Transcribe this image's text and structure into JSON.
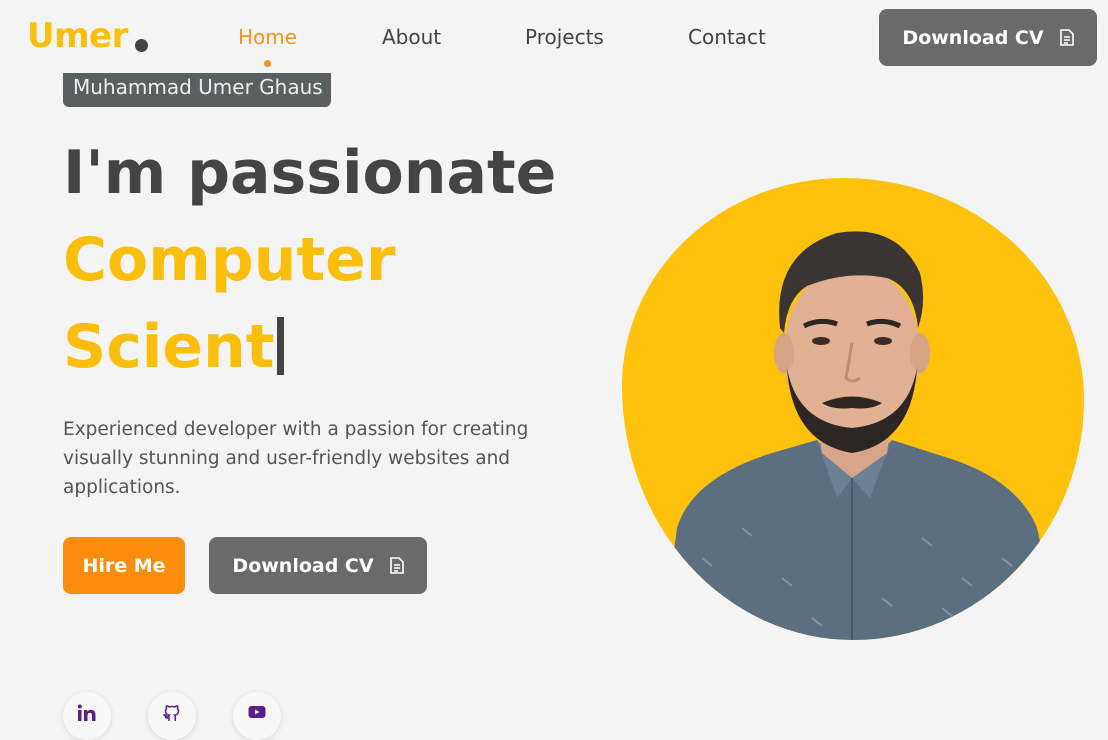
{
  "nav": {
    "logo": "Umer",
    "links": [
      "Home",
      "About",
      "Projects",
      "Contact"
    ],
    "active": "Home",
    "download_cv": "Download CV"
  },
  "hero": {
    "name_badge": "Muhammad Umer Ghaus",
    "line1": "I'm passionate",
    "line2": "Computer",
    "line3": "Scient",
    "description": "Experienced developer with a passion for creating visually stunning and user-friendly websites and applications.",
    "hire_me": "Hire Me",
    "download_cv": "Download CV"
  },
  "social": {
    "icons": [
      "linkedin-icon",
      "github-icon",
      "youtube-icon"
    ]
  },
  "colors": {
    "accent_yellow": "#fbbf0b",
    "accent_orange": "#fb8c0c",
    "button_grey": "#6a6a6a",
    "background": "#f4f4f4",
    "social_icon": "#5b1f8c"
  }
}
